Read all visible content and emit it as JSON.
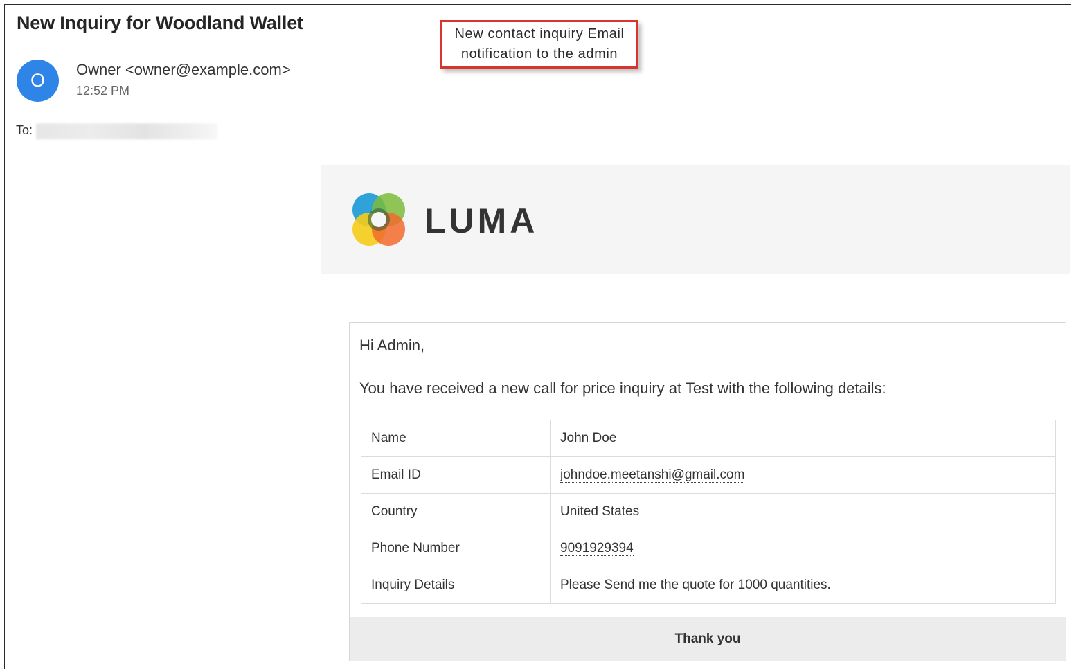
{
  "email": {
    "subject": "New Inquiry for Woodland Wallet",
    "avatar_letter": "O",
    "sender": "Owner <owner@example.com>",
    "time": "12:52 PM",
    "to_label": "To:"
  },
  "callout": {
    "line1": "New contact inquiry Email",
    "line2": "notification to the admin",
    "border_color": "#d9352f"
  },
  "brand": {
    "name": "LUMA",
    "logo_icon": "luma-logo-icon"
  },
  "body": {
    "greeting": "Hi Admin,",
    "intro": "You have received a new call for price inquiry at Test with the following details:",
    "rows": [
      {
        "label": "Name",
        "value": "John Doe"
      },
      {
        "label": "Email ID",
        "value": "johndoe.meetanshi@gmail.com"
      },
      {
        "label": "Country",
        "value": "United States"
      },
      {
        "label": "Phone Number",
        "value": "9091929394"
      },
      {
        "label": "Inquiry Details",
        "value": "Please Send me the quote for 1000 quantities."
      }
    ],
    "footer": "Thank you"
  },
  "colors": {
    "avatar": "#2f84e8",
    "header_band": "#f5f5f5",
    "footer_bar": "#ececec"
  }
}
